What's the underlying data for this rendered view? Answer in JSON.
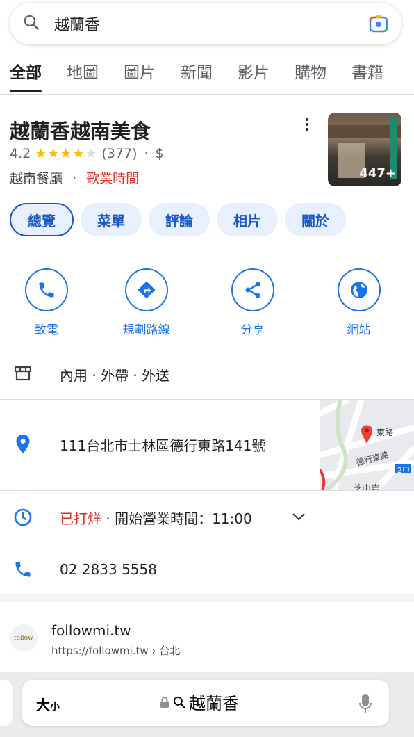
{
  "search": {
    "query": "越蘭香"
  },
  "tabs": [
    "全部",
    "地圖",
    "圖片",
    "新聞",
    "影片",
    "購物",
    "書籍"
  ],
  "business": {
    "name": "越蘭香越南美食",
    "rating": "4.2",
    "stars": 4.2,
    "reviews": "(377)",
    "price": "$",
    "category": "越南餐廳",
    "hours_link": "歌業時間",
    "photo_count": "447+"
  },
  "chips": [
    "總覽",
    "菜單",
    "評論",
    "相片",
    "關於"
  ],
  "actions": [
    {
      "label": "致電",
      "icon": "phone-icon"
    },
    {
      "label": "規劃路線",
      "icon": "directions-icon"
    },
    {
      "label": "分享",
      "icon": "share-icon"
    },
    {
      "label": "網站",
      "icon": "globe-icon"
    }
  ],
  "info": {
    "service_options": "內用 · 外帶 · 外送",
    "address": "111台北市士林區德行東路141號",
    "status": "已打烊",
    "hours": "· 開始營業時間：11:00",
    "phone": "02 2833 5558"
  },
  "map_labels": {
    "road1": "東路",
    "road2": "德行東路",
    "badge": "2甲",
    "bottom": "芝山岩"
  },
  "website": {
    "name": "followmi.tw",
    "url": "https://followmi.tw › 台北",
    "logo_text": "follow"
  },
  "browser": {
    "size_label": "大",
    "size_small": "小",
    "query": "越蘭香"
  },
  "colors": {
    "accent": "#1a73e8",
    "closed": "#d93025",
    "star": "#fbbc04"
  }
}
